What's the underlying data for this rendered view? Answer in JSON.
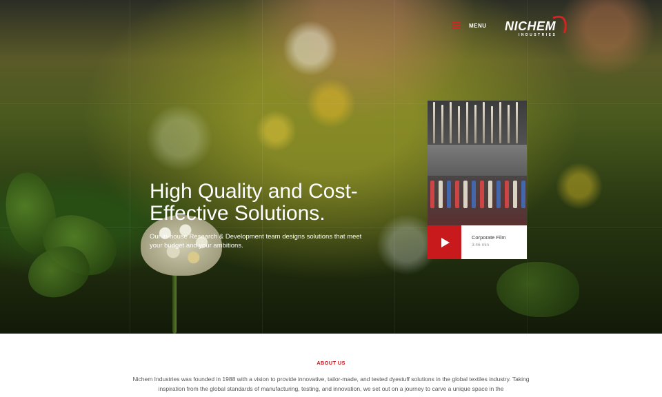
{
  "header": {
    "menu_label": "MENU",
    "logo_text": "NICHEM",
    "logo_subtext": "INDUSTRIES"
  },
  "hero": {
    "headline": "High Quality and Cost-Effective Solutions.",
    "subtext": "Our in-house Research & Development team designs solutions that meet your budget and your ambitions."
  },
  "video": {
    "title": "Corporate Film",
    "duration": "3:46 min"
  },
  "about": {
    "heading": "ABOUT US",
    "text": "Nichem Industries was founded in 1988 with a vision to provide innovative, tailor-made, and tested dyestuff solutions in the global textiles industry. Taking inspiration from the global standards of manufacturing, testing, and innovation, we set out on a journey to carve a unique space in the"
  },
  "colors": {
    "accent": "#c8191c",
    "white": "#ffffff",
    "body_text": "#555555"
  },
  "icons": [
    "hamburger-icon",
    "play-icon"
  ]
}
